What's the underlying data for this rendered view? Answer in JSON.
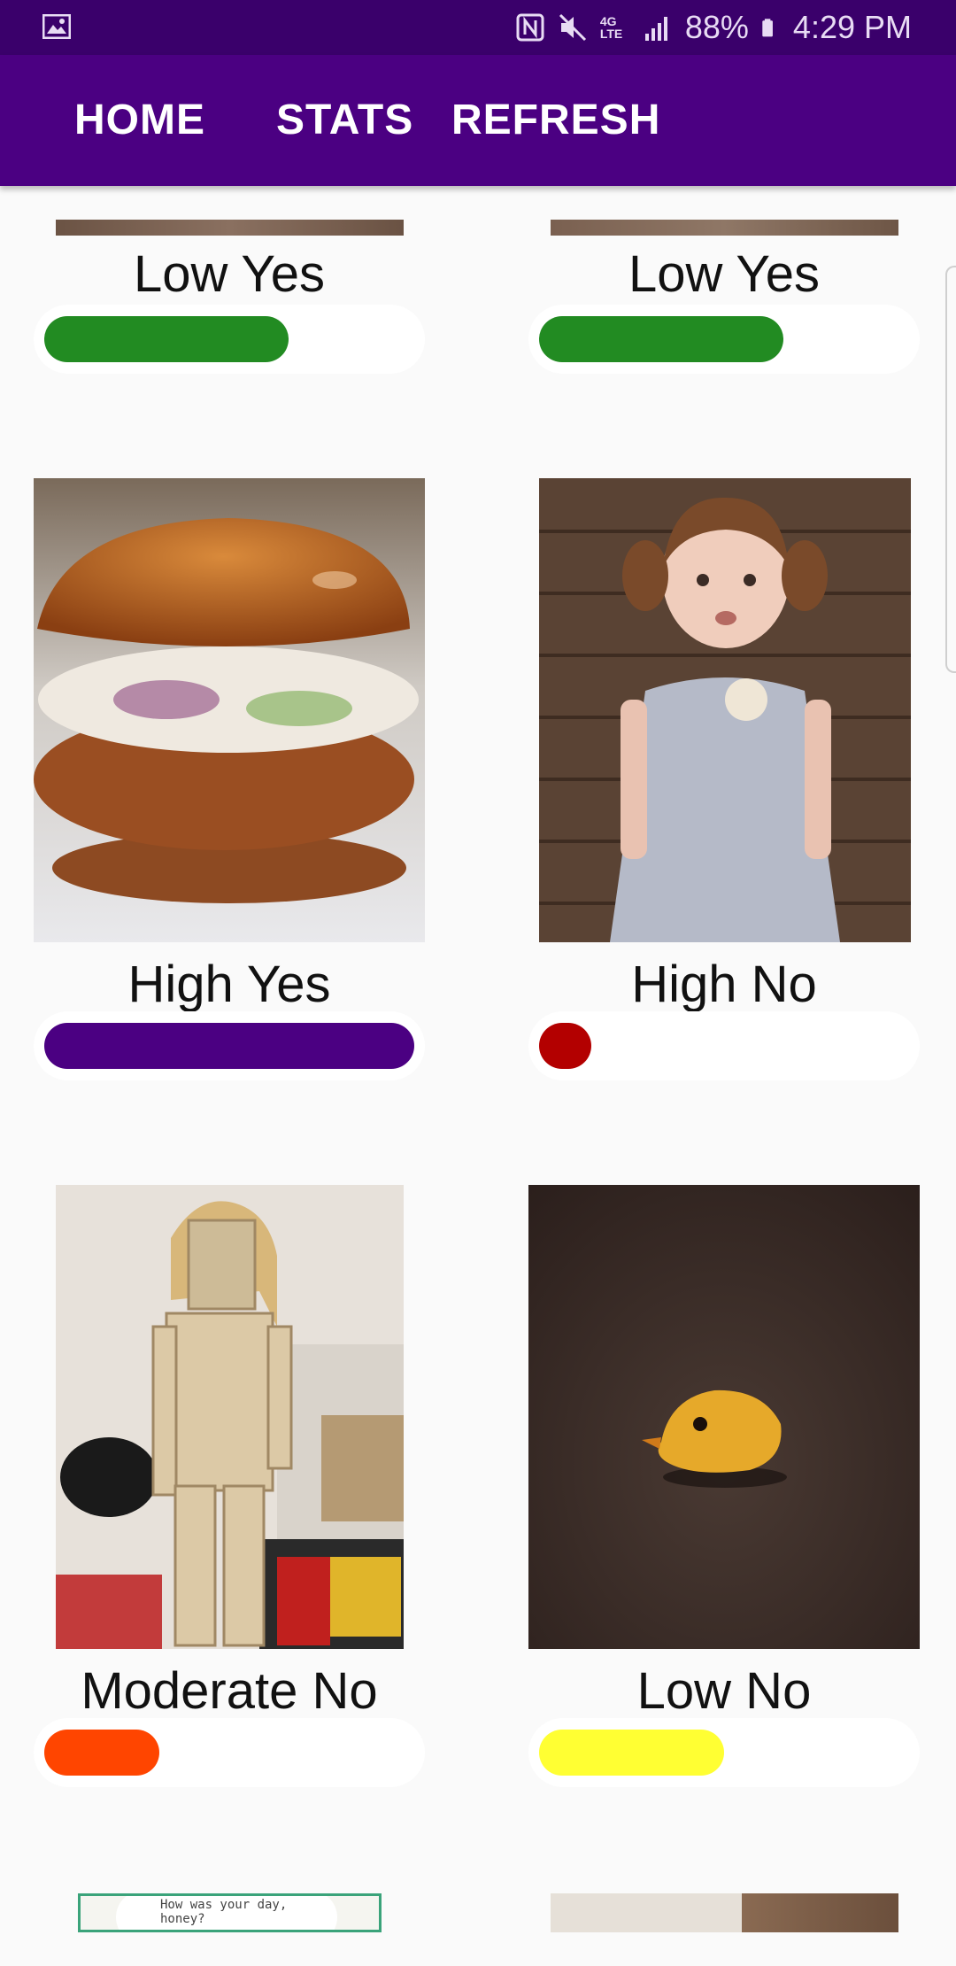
{
  "status_bar": {
    "battery": "88%",
    "time": "4:29 PM",
    "network": "4G LTE"
  },
  "nav": {
    "home_label": "HOME",
    "stats_label": "STATS",
    "refresh_label": "REFRESH"
  },
  "colors": {
    "status_bar": "#3a006b",
    "app_bar": "#4b0082",
    "green": "#228b22",
    "purple": "#4b0082",
    "red": "#b30000",
    "orange": "#ff4500",
    "yellow": "#ffff33"
  },
  "cards": [
    {
      "label": "Low Yes",
      "level": 0.66,
      "color": "#228b22",
      "image": "photo-cropped-top"
    },
    {
      "label": "Low Yes",
      "level": 0.66,
      "color": "#228b22",
      "image": "photo-cropped-top"
    },
    {
      "label": "High Yes",
      "level": 1.0,
      "color": "#4b0082",
      "image": "chicken-sandwich-photo"
    },
    {
      "label": "High No",
      "level": 0.14,
      "color": "#b30000",
      "image": "toddler-girl-photo"
    },
    {
      "label": "Moderate No",
      "level": 0.31,
      "color": "#ff4500",
      "image": "cracker-costume-photo"
    },
    {
      "label": "Low No",
      "level": 0.5,
      "color": "#ffff33",
      "image": "yellow-bird-photo"
    }
  ],
  "bottom_partial": {
    "comic_text": "How was your day, honey?"
  }
}
